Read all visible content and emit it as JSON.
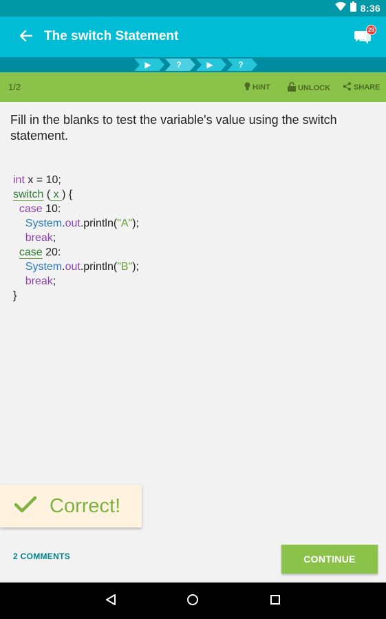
{
  "status_bar": {
    "time": "8:36",
    "icons": [
      "wifi-icon",
      "battery-icon"
    ]
  },
  "app_bar": {
    "title": "The switch Statement",
    "chat_badge_count": "29",
    "back_icon": "arrow-left-icon",
    "chat_icon": "chat-bubbles-icon"
  },
  "progress": {
    "steps": [
      {
        "symbol": "▶",
        "state": "done"
      },
      {
        "symbol": "?",
        "state": "current"
      },
      {
        "symbol": "▶",
        "state": "pending"
      },
      {
        "symbol": "?",
        "state": "pending"
      }
    ]
  },
  "lesson_bar": {
    "count": "1/2",
    "hint_label": "HINT",
    "unlock_label": "UNLOCK",
    "share_label": "SHARE"
  },
  "question": {
    "text": "Fill in the blanks to test the variable's value using the switch statement."
  },
  "code": {
    "line1": {
      "kw": "int",
      "rest": " x = 10;"
    },
    "line2": {
      "kw": "switch",
      "open": " (",
      "blank": " x ",
      "close": ") {"
    },
    "line3": {
      "indent": "  ",
      "kw": "case",
      "rest": " 10:"
    },
    "line4": {
      "indent": "    ",
      "cls": "System",
      "dot": ".",
      "out": "out",
      "call": ".println(",
      "str": "\"A\"",
      "end": ");"
    },
    "line5": {
      "indent": "    ",
      "kw": "break",
      "rest": ";"
    },
    "line6": {
      "indent": "  ",
      "kw": "case",
      "rest": " 20:"
    },
    "line7": {
      "indent": "    ",
      "cls": "System",
      "dot": ".",
      "out": "out",
      "call": ".println(",
      "str": "\"B\"",
      "end": ");"
    },
    "line8": {
      "indent": "    ",
      "kw": "break",
      "rest": ";"
    },
    "line9": {
      "rest": "}"
    }
  },
  "feedback": {
    "label": "Correct!",
    "icon": "checkmark-icon"
  },
  "footer": {
    "comments_label": "2 COMMENTS",
    "continue_label": "CONTINUE"
  },
  "colors": {
    "primary": "#00bcd4",
    "accent_green": "#8bc34a",
    "keyword": "#8e44ad",
    "class": "#2a7db7",
    "string": "#689f38"
  }
}
